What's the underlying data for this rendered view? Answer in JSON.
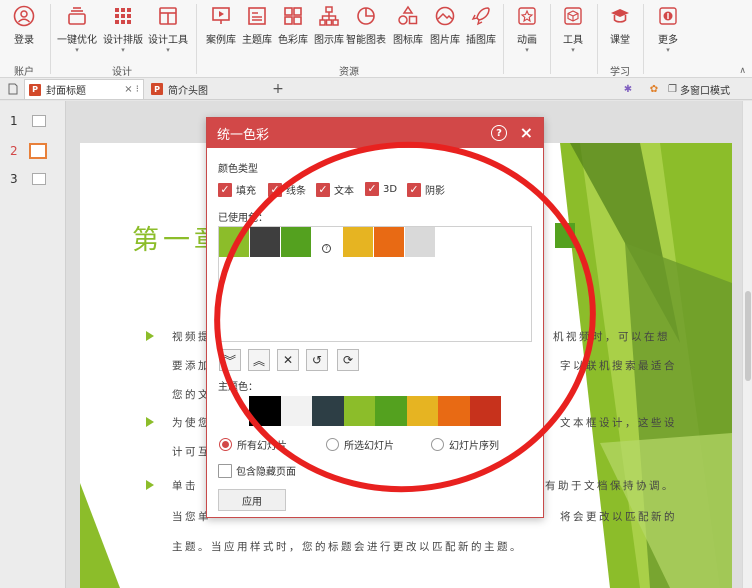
{
  "ribbon": {
    "login": "登录",
    "one_click": "一键优化",
    "design_layout": "设计排版",
    "design_tools": "设计工具",
    "case_lib": "案例库",
    "theme_lib": "主题库",
    "color_lib": "色彩库",
    "diagram_lib": "图示库",
    "smart_chart": "智能图表",
    "icon_lib": "图标库",
    "image_lib": "图片库",
    "illustration_lib": "插图库",
    "animation": "动画",
    "tools": "工具",
    "classroom": "课堂",
    "more": "更多",
    "group_account": "账户",
    "group_design": "设计",
    "group_resources": "资源",
    "group_learning": "学习"
  },
  "tabs": {
    "tab1": "封面标题",
    "tab2": "简介头图",
    "add": "+",
    "multi_window": "多窗口模式"
  },
  "thumbs": [
    "1",
    "2",
    "3"
  ],
  "slide": {
    "title": "第一章",
    "lines": [
      "视频提",
      "要添加",
      "您的文",
      "为使您",
      "计可互",
      "单击",
      "当您单",
      "机视频时，可以在想",
      "字以联机搜索最适合",
      "文本框设计，这些设",
      "有助于文档保持协调。",
      "将会更改以匹配新的",
      "主题。当应用样式时，您的标题会进行更改以匹配新的主题。"
    ]
  },
  "dialog": {
    "title": "统一色彩",
    "help": "?",
    "close": "×",
    "color_type_label": "颜色类型",
    "checks": [
      "填充",
      "线条",
      "文本",
      "3D",
      "阴影"
    ],
    "used_label": "已使用色：",
    "theme_label": "主题色：",
    "scope_options": [
      "所有幻灯片",
      "所选幻灯片",
      "幻灯片序列"
    ],
    "hidden_pages": "包含隐藏页面",
    "apply": "应用",
    "used_colors": [
      "#8cbd2a",
      "#3e3e3e",
      "#54a11f",
      "#ffffff",
      "#e6b422",
      "#e86a14",
      "#d9d9d9"
    ],
    "theme_colors": [
      "#ffffff",
      "#000000",
      "#f2f2f2",
      "#2d3e45",
      "#8cbd2a",
      "#54a11f",
      "#e6b422",
      "#e86a14",
      "#c7321c",
      "#938a5e"
    ]
  },
  "colors": {
    "accent": "#d24848",
    "title_green": "#8cbd2a",
    "annotation_red": "#e8211f"
  }
}
